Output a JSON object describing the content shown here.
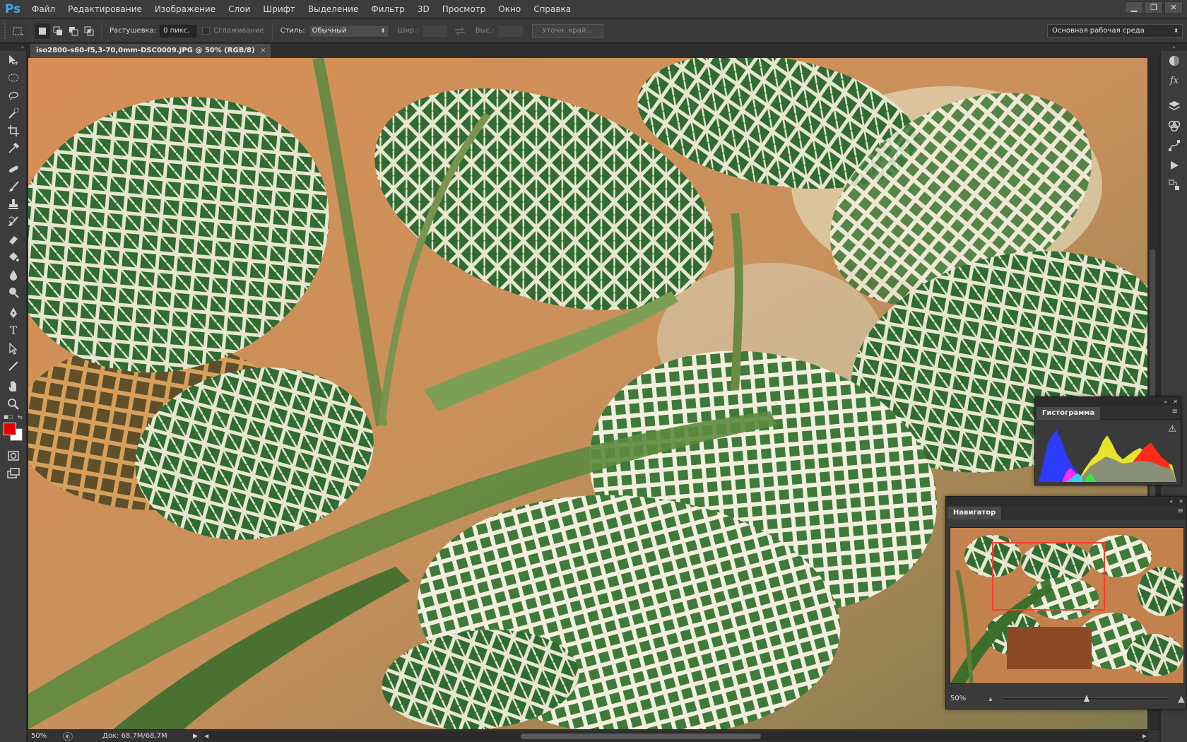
{
  "app": {
    "logo": "Ps"
  },
  "menu": {
    "items": [
      "Файл",
      "Редактирование",
      "Изображение",
      "Слои",
      "Шрифт",
      "Выделение",
      "Фильтр",
      "3D",
      "Просмотр",
      "Окно",
      "Справка"
    ]
  },
  "window_controls": {
    "minimize": "▁",
    "restore": "❐",
    "close": "✕"
  },
  "options": {
    "feather_label": "Растушевка:",
    "feather_value": "0 пикс.",
    "antialias_label": "Сглаживание",
    "style_label": "Стиль:",
    "style_value": "Обычный",
    "width_label": "Шир.:",
    "height_label": "Выс.:",
    "refine_button": "Уточн. край...",
    "workspace": "Основная рабочая среда"
  },
  "document": {
    "tab_title": "iso2800-s60-f5,3-70,0mm-DSC0009.JPG @ 50% (RGB/8)",
    "tab_close": "×"
  },
  "status": {
    "zoom": "50%",
    "doc_size": "Док: 68,7M/68,7M",
    "arrow": "▶"
  },
  "colors": {
    "foreground": "#e60000",
    "background": "#ffffff",
    "navigator_box": "#ff3d2e",
    "accent": "#3da8e8"
  },
  "histogram": {
    "title": "Гистограмма",
    "warning_icon": "warning-icon"
  },
  "navigator": {
    "title": "Навигатор",
    "zoom": "50%",
    "zoom_slider_fraction": 0.5
  },
  "tools": [
    "move-tool-icon",
    "marquee-tool-icon",
    "lasso-tool-icon",
    "quick-select-tool-icon",
    "crop-tool-icon",
    "eyedropper-tool-icon",
    "healing-brush-tool-icon",
    "brush-tool-icon",
    "clone-stamp-tool-icon",
    "history-brush-tool-icon",
    "eraser-tool-icon",
    "paint-bucket-tool-icon",
    "blur-tool-icon",
    "dodge-tool-icon",
    "pen-tool-icon",
    "type-tool-icon",
    "path-select-tool-icon",
    "line-tool-icon",
    "hand-tool-icon",
    "zoom-tool-icon"
  ],
  "dock": [
    "color-wheel-icon",
    "adjustments-icon",
    "layers-icon",
    "channels-icon",
    "paths-icon",
    "actions-icon",
    "history-icon"
  ]
}
